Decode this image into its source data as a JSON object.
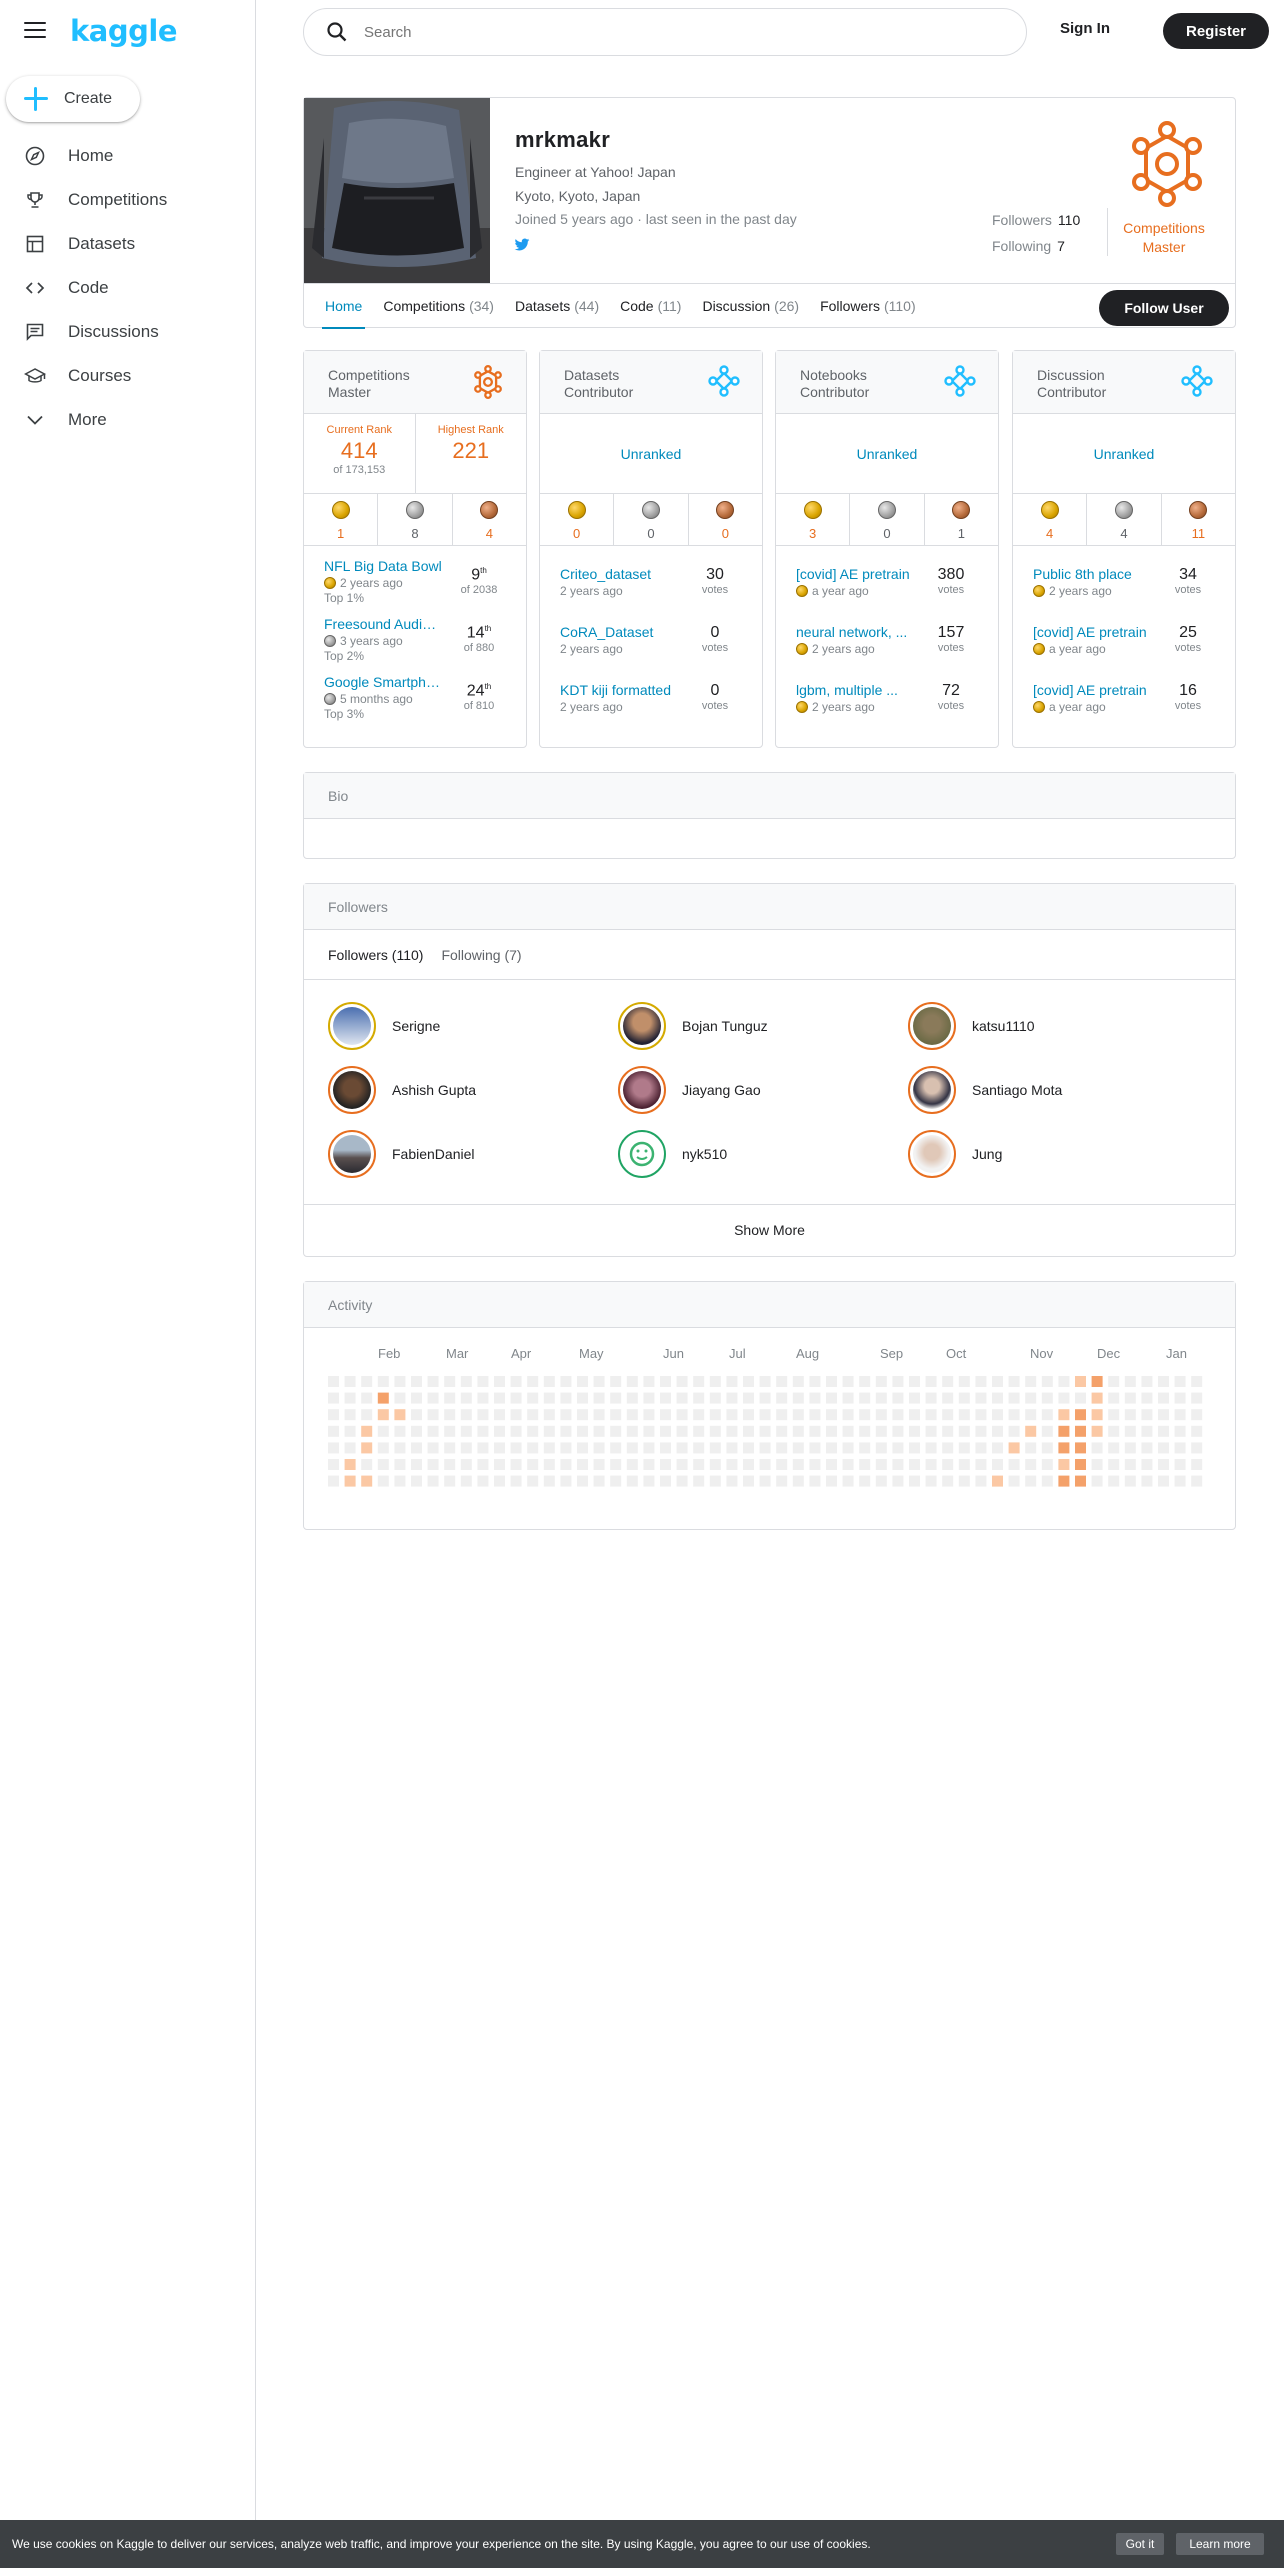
{
  "app": {
    "logo": "kaggle"
  },
  "sidebar": {
    "create_label": "Create",
    "items": [
      {
        "label": "Home",
        "icon": "compass-icon"
      },
      {
        "label": "Competitions",
        "icon": "trophy-icon"
      },
      {
        "label": "Datasets",
        "icon": "table-icon"
      },
      {
        "label": "Code",
        "icon": "code-icon"
      },
      {
        "label": "Discussions",
        "icon": "chat-icon"
      },
      {
        "label": "Courses",
        "icon": "school-icon"
      },
      {
        "label": "More",
        "icon": "chevron-down-icon"
      }
    ]
  },
  "header": {
    "search_placeholder": "Search",
    "signin": "Sign In",
    "register": "Register"
  },
  "profile": {
    "name": "mrkmakr",
    "occupation": "Engineer at Yahoo! Japan",
    "location": "Kyoto, Kyoto, Japan",
    "joined": "Joined 5 years ago · last seen in the past day",
    "followers_label": "Followers",
    "followers_count": "110",
    "following_label": "Following",
    "following_count": "7",
    "tier_line1": "Competitions",
    "tier_line2": "Master",
    "follow_button": "Follow User",
    "tabs": [
      {
        "label": "Home",
        "count": ""
      },
      {
        "label": "Competitions",
        "count": "(34)"
      },
      {
        "label": "Datasets",
        "count": "(44)"
      },
      {
        "label": "Code",
        "count": "(11)"
      },
      {
        "label": "Discussion",
        "count": "(26)"
      },
      {
        "label": "Followers",
        "count": "(110)"
      }
    ]
  },
  "tiers": {
    "competitions": {
      "title1": "Competitions",
      "title2": "Master",
      "current_rank_label": "Current Rank",
      "current_rank": "414",
      "current_rank_of": "of 173,153",
      "highest_rank_label": "Highest Rank",
      "highest_rank": "221",
      "gold": "1",
      "silver": "8",
      "bronze": "4",
      "items": [
        {
          "title": "NFL Big Data Bowl",
          "medal": "gold",
          "meta": "2 years ago",
          "meta2": "Top 1%",
          "value": "9",
          "sup": "th",
          "unit": "of 2038"
        },
        {
          "title": "Freesound Audio Tagging",
          "medal": "silver",
          "meta": "3 years ago",
          "meta2": "Top 2%",
          "value": "14",
          "sup": "th",
          "unit": "of 880"
        },
        {
          "title": "Google Smartphone",
          "medal": "silver",
          "meta": "5 months ago",
          "meta2": "Top 3%",
          "value": "24",
          "sup": "th",
          "unit": "of 810"
        }
      ]
    },
    "datasets": {
      "title1": "Datasets",
      "title2": "Contributor",
      "unranked": "Unranked",
      "gold": "0",
      "silver": "0",
      "bronze": "0",
      "items": [
        {
          "title": "Criteo_dataset",
          "medal": "",
          "meta": "2 years ago",
          "value": "30",
          "unit": "votes"
        },
        {
          "title": "CoRA_Dataset",
          "medal": "",
          "meta": "2 years ago",
          "value": "0",
          "unit": "votes"
        },
        {
          "title": "KDT kiji formatted",
          "medal": "",
          "meta": "2 years ago",
          "value": "0",
          "unit": "votes"
        }
      ]
    },
    "notebooks": {
      "title1": "Notebooks",
      "title2": "Contributor",
      "unranked": "Unranked",
      "gold": "3",
      "silver": "0",
      "bronze": "1",
      "items": [
        {
          "title": "[covid] AE pretrain",
          "medal": "gold",
          "meta": "a year ago",
          "value": "380",
          "unit": "votes"
        },
        {
          "title": "neural network, ...",
          "medal": "gold",
          "meta": "2 years ago",
          "value": "157",
          "unit": "votes"
        },
        {
          "title": "lgbm, multiple ...",
          "medal": "gold",
          "meta": "2 years ago",
          "value": "72",
          "unit": "votes"
        }
      ]
    },
    "discussion": {
      "title1": "Discussion",
      "title2": "Contributor",
      "unranked": "Unranked",
      "gold": "4",
      "silver": "4",
      "bronze": "11",
      "items": [
        {
          "title": "Public 8th place",
          "medal": "gold",
          "meta": "2 years ago",
          "value": "34",
          "unit": "votes"
        },
        {
          "title": "[covid] AE pretrain",
          "medal": "gold",
          "meta": "a year ago",
          "value": "25",
          "unit": "votes"
        },
        {
          "title": "[covid] AE pretrain",
          "medal": "gold",
          "meta": "a year ago",
          "value": "16",
          "unit": "votes"
        }
      ]
    }
  },
  "bio": {
    "title": "Bio"
  },
  "followers": {
    "title": "Followers",
    "tab_followers": "Followers (110)",
    "tab_following": "Following (7)",
    "list": [
      {
        "name": "Serigne",
        "ring": "#d4aa00"
      },
      {
        "name": "Bojan Tunguz",
        "ring": "#d4aa00"
      },
      {
        "name": "katsu1110",
        "ring": "#e76e1f"
      },
      {
        "name": "Ashish Gupta",
        "ring": "#e76e1f"
      },
      {
        "name": "Jiayang Gao",
        "ring": "#e76e1f"
      },
      {
        "name": "Santiago Mota",
        "ring": "#e76e1f"
      },
      {
        "name": "FabienDaniel",
        "ring": "#e76e1f"
      },
      {
        "name": "nyk510",
        "ring": "#20a464"
      },
      {
        "name": "Jung",
        "ring": "#e76e1f"
      }
    ],
    "show_more": "Show More"
  },
  "activity": {
    "title": "Activity",
    "months": [
      "Feb",
      "Mar",
      "Apr",
      "May",
      "Jun",
      "Jul",
      "Aug",
      "Sep",
      "Oct",
      "Nov",
      "Dec",
      "Jan"
    ]
  },
  "cookie": {
    "text": "We use cookies on Kaggle to deliver our services, analyze web traffic, and improve your experience on the site. By using Kaggle, you agree to our use of cookies.",
    "got_it": "Got it",
    "learn_more": "Learn more"
  },
  "colors": {
    "brand": "#20beff",
    "link": "#008abc",
    "master": "#e76e1f",
    "contributor": "#20beff"
  }
}
